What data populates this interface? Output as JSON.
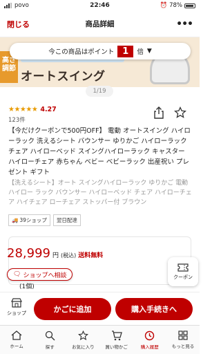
{
  "status_bar": {
    "carrier": "povo",
    "time": "22:46",
    "battery": "78%"
  },
  "nav": {
    "close_label": "閉じる",
    "title": "商品詳細",
    "more_icon": "more-dots-icon"
  },
  "hero": {
    "badge_text": "高さ調節",
    "headline": "オートスイング"
  },
  "point_banner": {
    "prefix": "今この商品はポイント",
    "multiplier": "1",
    "suffix": "倍"
  },
  "pager": {
    "text": "1/19"
  },
  "rating": {
    "score": "4.27",
    "review_count": "123件",
    "stars": 4.27
  },
  "product": {
    "title": "【今だけクーポンで500円OFF】 電動 オートスイング ハイローラック 洗えるシート バウンサー ゆりかご ハイローラック チェア ハイローベッド スイングハイローラック キャスター ハイローチェア 赤ちゃん ベビー ベビーラック 出産祝い プレゼント ギフト",
    "subtitle": "【洗えるシート】オート スイングハイローラック ゆりかご 電動 ハイロー ラック バウンサー ハイローベッド チェア ハイローチェア ハイチェア ローチェア ストッパー付 ブラウン"
  },
  "tags": [
    {
      "label": "39ショップ",
      "icon": "truck-icon"
    },
    {
      "label": "翌日配達",
      "icon": ""
    }
  ],
  "price": {
    "amount": "28,999",
    "yen": "円",
    "tax_note": "(税込)",
    "shipping": "送料無料",
    "qty_note": "(1個)"
  },
  "shop_consult_label": "ショップへ相談",
  "coupon_label": "クーポン",
  "action_bar": {
    "shop_label": "ショップ",
    "cart_label": "かごに追加",
    "buy_label": "購入手続きへ"
  },
  "tabbar": [
    {
      "label": "ホーム",
      "icon": "home-icon"
    },
    {
      "label": "探す",
      "icon": "search-icon"
    },
    {
      "label": "お気に入り",
      "icon": "star-icon"
    },
    {
      "label": "買い物かご",
      "icon": "cart-icon"
    },
    {
      "label": "購入履歴",
      "icon": "history-icon"
    },
    {
      "label": "もっと見る",
      "icon": "grid-icon"
    }
  ],
  "colors": {
    "accent": "#bf0000",
    "star": "#e89b00"
  }
}
